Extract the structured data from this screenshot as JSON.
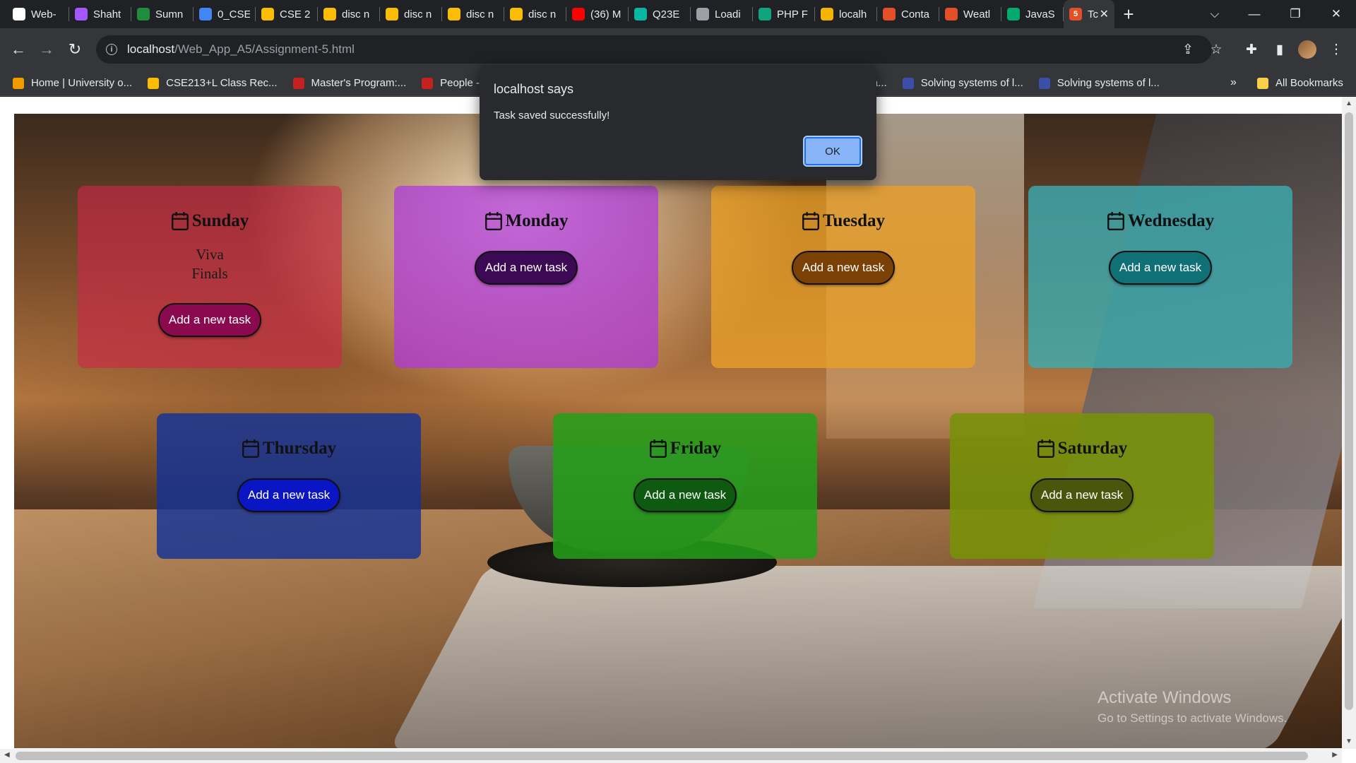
{
  "browser": {
    "tabs": [
      {
        "label": "Web-",
        "icon": "github-icon",
        "color": "#ffffff"
      },
      {
        "label": "Shaht",
        "icon": "messenger-icon",
        "color": "#a259ff"
      },
      {
        "label": "Sumn",
        "icon": "classroom-icon",
        "color": "#1e8e3e"
      },
      {
        "label": "0_CSE",
        "icon": "docs-icon",
        "color": "#4285f4"
      },
      {
        "label": "CSE 2",
        "icon": "drive-icon",
        "color": "#fbbc04"
      },
      {
        "label": "disc n",
        "icon": "drive-icon",
        "color": "#fbbc04"
      },
      {
        "label": "disc n",
        "icon": "drive-icon",
        "color": "#fbbc04"
      },
      {
        "label": "disc n",
        "icon": "drive-icon",
        "color": "#fbbc04"
      },
      {
        "label": "disc n",
        "icon": "drive-icon",
        "color": "#fbbc04"
      },
      {
        "label": "(36) M",
        "icon": "youtube-icon",
        "color": "#ff0000"
      },
      {
        "label": "Q23E",
        "icon": "codeium-icon",
        "color": "#09b6a2"
      },
      {
        "label": "Loadi",
        "icon": "globe-icon",
        "color": "#9aa0a6"
      },
      {
        "label": "PHP F",
        "icon": "chatgpt-icon",
        "color": "#10a37f"
      },
      {
        "label": "localh",
        "icon": "xampp-icon",
        "color": "#f4b400"
      },
      {
        "label": "Conta",
        "icon": "html5-icon",
        "color": "#e34f26"
      },
      {
        "label": "Weatl",
        "icon": "html5-icon",
        "color": "#e34f26"
      },
      {
        "label": "JavaS",
        "icon": "w3schools-icon",
        "color": "#04aa6d"
      }
    ],
    "active_tab": {
      "label": "Tc",
      "icon": "html5-icon",
      "color": "#e34f26"
    },
    "url_host": "localhost",
    "url_path": "/Web_App_A5/Assignment-5.html",
    "bookmarks": [
      {
        "label": "Home | University o...",
        "color": "#f29900"
      },
      {
        "label": "CSE213+L Class Rec...",
        "color": "#fbbc04"
      },
      {
        "label": "Master's Program:...",
        "color": "#c5221f"
      },
      {
        "label": "People - K",
        "color": "#c5221f"
      },
      {
        "label": "rmulas – Ba...",
        "color": ""
      },
      {
        "label": "Solving systems of l...",
        "color": "#3c4fa8"
      },
      {
        "label": "Solving systems of l...",
        "color": "#3c4fa8"
      }
    ],
    "bookmarks_overflow": "»",
    "all_bookmarks": "All Bookmarks"
  },
  "dialog": {
    "title": "localhost says",
    "message": "Task saved successfully!",
    "ok_label": "OK"
  },
  "days": [
    {
      "name": "Sunday",
      "tasks": [
        "Viva",
        "Finals"
      ],
      "button": "Add a new task",
      "card_color": "rgba(205,38,72,0.62)",
      "button_color": "#8b0a4f"
    },
    {
      "name": "Monday",
      "tasks": [],
      "button": "Add a new task",
      "card_color": "rgba(175,55,225,0.72)",
      "button_color": "#3c0a55"
    },
    {
      "name": "Tuesday",
      "tasks": [],
      "button": "Add a new task",
      "card_color": "rgba(234,160,40,0.78)",
      "button_color": "#7a4006"
    },
    {
      "name": "Wednesday",
      "tasks": [],
      "button": "Add a new task",
      "card_color": "rgba(60,170,175,0.82)",
      "button_color": "#0f7175"
    },
    {
      "name": "Thursday",
      "tasks": [],
      "button": "Add a new task",
      "card_color": "rgba(20,50,150,0.82)",
      "button_color": "#0a16c4"
    },
    {
      "name": "Friday",
      "tasks": [],
      "button": "Add a new task",
      "card_color": "rgba(35,160,25,0.85)",
      "button_color": "#0d5a10"
    },
    {
      "name": "Saturday",
      "tasks": [],
      "button": "Add a new task",
      "card_color": "rgba(120,145,10,0.9)",
      "button_color": "#4a560c"
    }
  ],
  "watermark": {
    "title": "Activate Windows",
    "subtitle": "Go to Settings to activate Windows."
  }
}
